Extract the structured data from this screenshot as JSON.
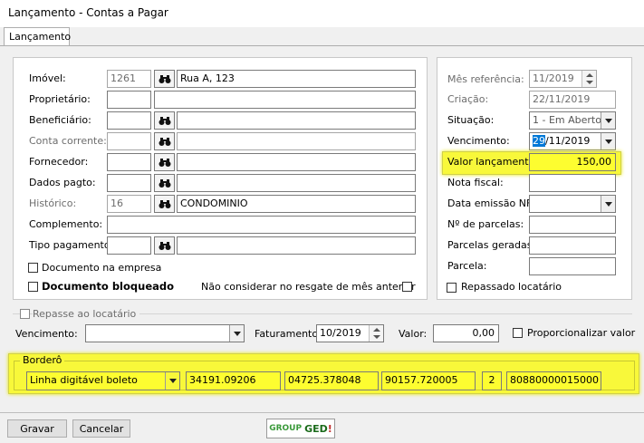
{
  "window": {
    "title": "Lançamento - Contas a Pagar"
  },
  "tabs": [
    {
      "label": "Lançamento"
    }
  ],
  "left": {
    "imovel": {
      "label": "Imóvel:",
      "code": "1261",
      "desc": "Rua A, 123"
    },
    "proprietario": {
      "label": "Proprietário:"
    },
    "beneficiario": {
      "label": "Beneficiário:"
    },
    "conta_corrente": {
      "label": "Conta corrente:"
    },
    "fornecedor": {
      "label": "Fornecedor:"
    },
    "dados_pagto": {
      "label": "Dados pagto:"
    },
    "historico": {
      "label": "Histórico:",
      "code": "16",
      "desc": "CONDOMINIO"
    },
    "complemento": {
      "label": "Complemento:"
    },
    "tipo_pagamento": {
      "label": "Tipo pagamento:"
    },
    "doc_empresa": {
      "label": "Documento na empresa"
    },
    "doc_bloqueado": {
      "label": "Documento bloqueado"
    },
    "nao_considerar": {
      "label": "Não considerar no resgate de mês anterior"
    }
  },
  "right": {
    "mes_referencia": {
      "label": "Mês referência:",
      "value": "11/2019"
    },
    "criacao": {
      "label": "Criação:",
      "value": "22/11/2019"
    },
    "situacao": {
      "label": "Situação:",
      "value": "1 - Em Aberto"
    },
    "vencimento": {
      "label": "Vencimento:",
      "day": "29",
      "rest": "/11/2019"
    },
    "valor_lancamento": {
      "label": "Valor lançamento:",
      "value": "150,00"
    },
    "nota_fiscal": {
      "label": "Nota fiscal:"
    },
    "data_emissao_nf": {
      "label": "Data emissão NF:"
    },
    "n_parcelas": {
      "label": "Nº de parcelas:"
    },
    "parcelas_geradas": {
      "label": "Parcelas geradas:"
    },
    "parcela": {
      "label": "Parcela:"
    },
    "repassado_locatario": {
      "label": "Repassado locatário"
    }
  },
  "repasse": {
    "title": "Repasse ao locatário",
    "vencimento_label": "Vencimento:",
    "faturamento_label": "Faturamento:",
    "faturamento_value": "10/2019",
    "valor_label": "Valor:",
    "valor_value": "0,00",
    "proporcionalizar_label": "Proporcionalizar valor"
  },
  "bordero": {
    "title": "Borderô",
    "tipo": "Linha digitável boleto",
    "campo1": "34191.09206",
    "campo2": "04725.378048",
    "campo3": "90157.720005",
    "campo4": "2",
    "campo5": "80880000015000"
  },
  "footer": {
    "gravar_label": "Gravar",
    "cancelar_label": "Cancelar",
    "logo_group": "GROUP",
    "logo_ged": "GED"
  },
  "colors": {
    "highlight": "#f8f83a",
    "selection": "#0078d7",
    "logo_green": "#3a9a3a"
  }
}
